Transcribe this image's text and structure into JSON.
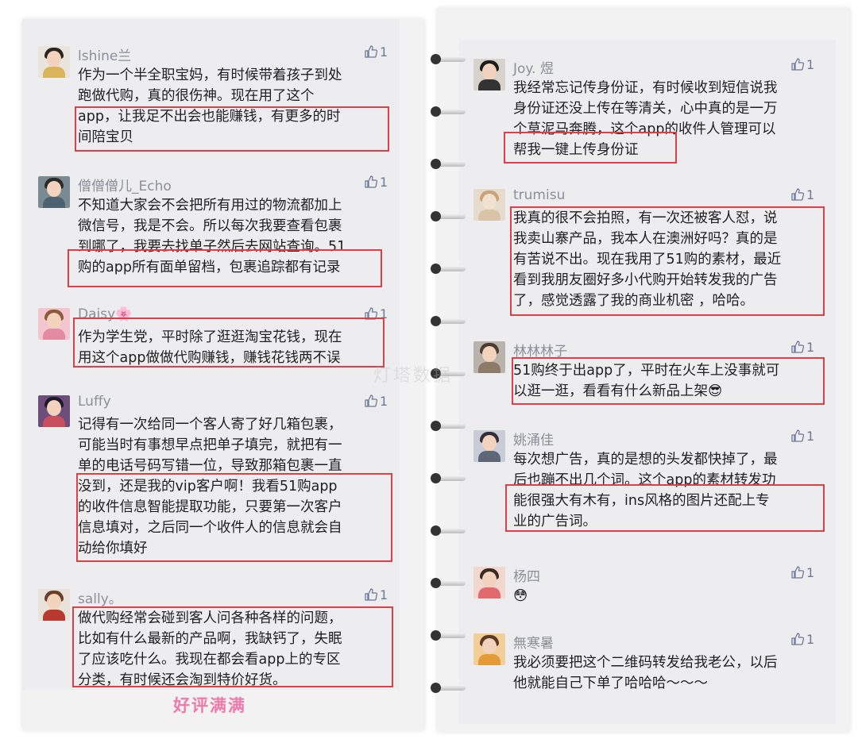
{
  "colors": {
    "highlight_box": "#d8404a",
    "caption": "#ef79a9",
    "like": "#6c7a99",
    "username": "#8a8f99"
  },
  "icons": {
    "like": "thumbs-up-icon"
  },
  "left_comments": [
    {
      "user": "lshine兰",
      "likes": "1",
      "lines": [
        "作为一个半全职宝妈，有时候带着孩子到处",
        "跑做代购，真的很伤神。现在用了这个",
        "app，让我足不出会也能赚钱，有更多的时",
        "间陪宝贝"
      ]
    },
    {
      "user": "僧僧僧儿_Echo",
      "likes": "1",
      "lines": [
        "不知道大家会不会把所有用过的物流都加上",
        "微信号，我是不会。所以每次我要查看包裹",
        "到哪了，我要去找单子然后去网站查询。51",
        "购的app所有面单留档，包裹追踪都有记录"
      ]
    },
    {
      "user": "Daisy🌸",
      "likes": "1",
      "lines": [
        "作为学生党，平时除了逛逛淘宝花钱，现在",
        "用这个app做做代购赚钱，赚钱花钱两不误"
      ]
    },
    {
      "user": "Luffy",
      "likes": "1",
      "lines": [
        "记得有一次给同一个客人寄了好几箱包裹，",
        "可能当时有事想早点把单子填完，就把有一",
        "单的电话号码写错一位，导致那箱包裹一直",
        "没到，还是我的vip客户啊！我看51购app",
        "的收件信息智能提取功能，只要第一次客户",
        "信息填对，之后同一个收件人的信息就会自",
        "动给你填好"
      ]
    },
    {
      "user": "sally。",
      "likes": "1",
      "lines": [
        "做代购经常会碰到客人问各种各样的问题，",
        "比如有什么最新的产品啊，我缺钙了，失眠",
        "了应该吃什么。我现在都会看app上的专区",
        "分类，有时候还会淘到特价好货。"
      ]
    }
  ],
  "right_comments": [
    {
      "user": "Joy. 煜",
      "likes": "1",
      "lines": [
        "我经常忘记传身份证，有时候收到短信说我",
        "身份证还没上传在等清关，心中真的是一万",
        "个草泥马奔腾，这个app的收件人管理可以",
        "帮我一键上传身份证"
      ]
    },
    {
      "user": "trumisu",
      "likes": "1",
      "lines": [
        "我真的很不会拍照，有一次还被客人怼，说",
        "我卖山寨产品，我本人在澳洲好吗？真的是",
        "有苦说不出。现在我用了51购的素材，最近",
        "看到我朋友圈好多小代购开始转发我的广告",
        "了，感觉透露了我的商业机密 ，哈哈。"
      ]
    },
    {
      "user": "林林林子",
      "likes": "1",
      "lines": [
        "51购终于出app了，平时在火车上没事就可",
        "以逛一逛，看看有什么新品上架😎"
      ]
    },
    {
      "user": "姚涌佳",
      "likes": "1",
      "lines": [
        "每次想广告，真的是想的头发都快掉了，最",
        "后也蹦不出几个词。这个app的素材转发功",
        "能很强大有木有，ins风格的图片还配上专",
        "业的广告词。"
      ]
    },
    {
      "user": "杨四",
      "likes": "1",
      "lines": [
        "😳"
      ]
    },
    {
      "user": "無寒暑",
      "likes": "1",
      "lines": [
        "我必须要把这个二维码转发给我老公，以后",
        "他就能自己下单了哈哈哈～～～"
      ]
    }
  ],
  "caption": "好评满满",
  "watermark": "灯塔数据"
}
